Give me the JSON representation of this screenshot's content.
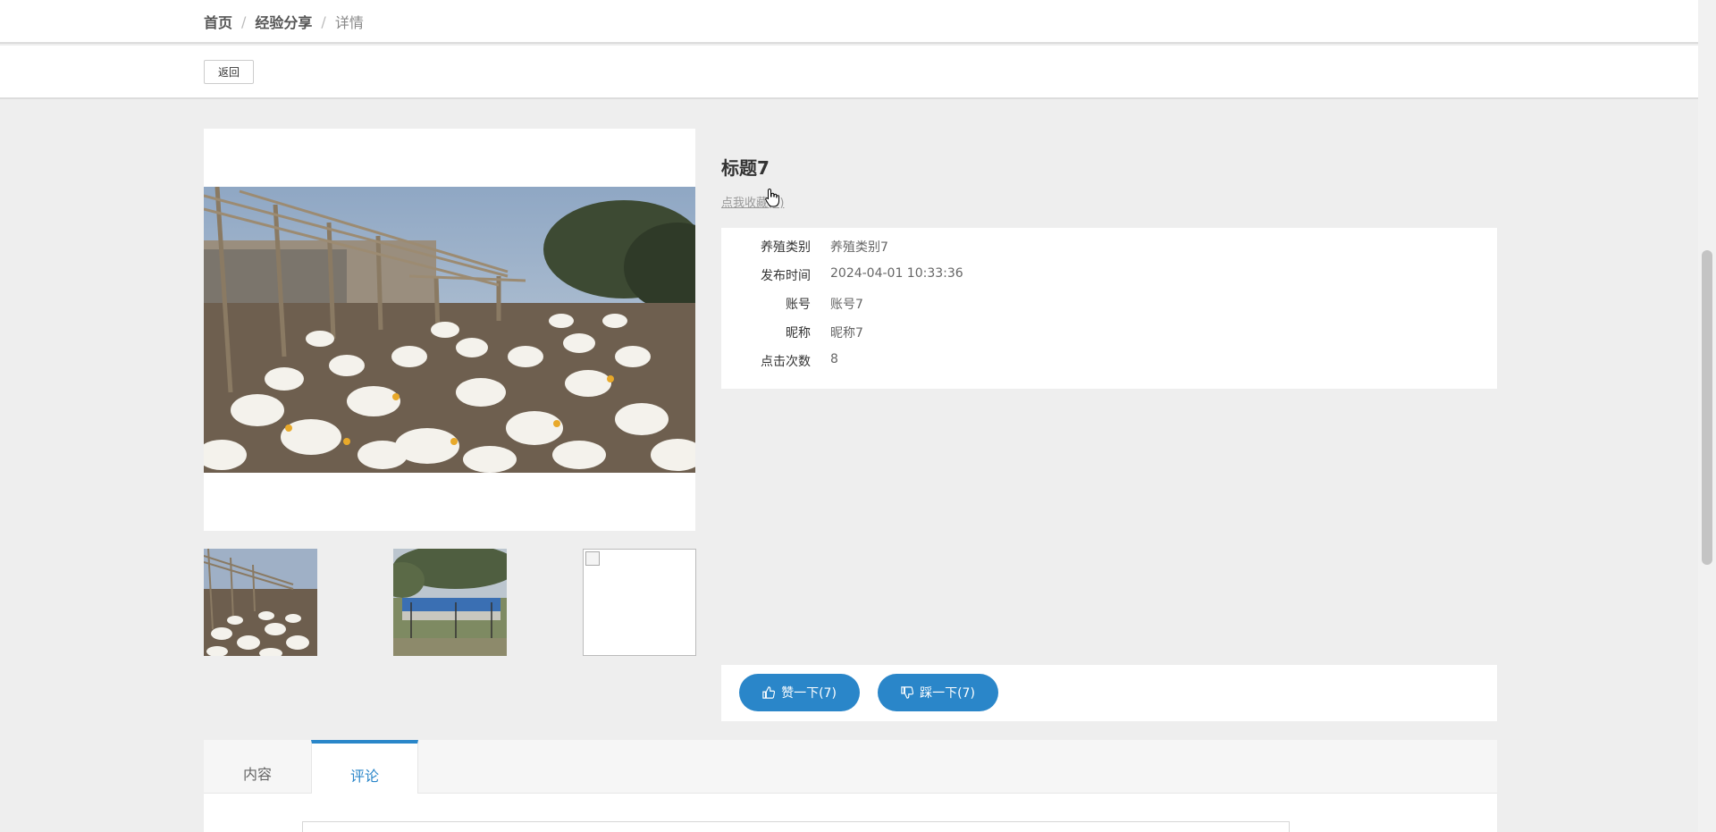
{
  "breadcrumb": {
    "home": "首页",
    "section": "经验分享",
    "current": "详情",
    "separator": "/"
  },
  "toolbar": {
    "back_label": "返回"
  },
  "detail": {
    "title": "标题7",
    "favorite_label": "点我收藏(0)"
  },
  "info": {
    "category_label": "养殖类别",
    "category_value": "养殖类别7",
    "time_label": "发布时间",
    "time_value": "2024-04-01 10:33:36",
    "account_label": "账号",
    "account_value": "账号7",
    "nickname_label": "昵称",
    "nickname_value": "昵称7",
    "clicks_label": "点击次数",
    "clicks_value": "8"
  },
  "votes": {
    "like_label": "赞一下(7)",
    "dislike_label": "踩一下(7)"
  },
  "tabs": {
    "content_label": "内容",
    "comment_label": "评论"
  },
  "icons": {
    "like": "thumbs-up-icon",
    "dislike": "thumbs-down-icon",
    "broken": "broken-image-icon"
  },
  "colors": {
    "accent": "#2a86c9",
    "background": "#eeeeee"
  }
}
